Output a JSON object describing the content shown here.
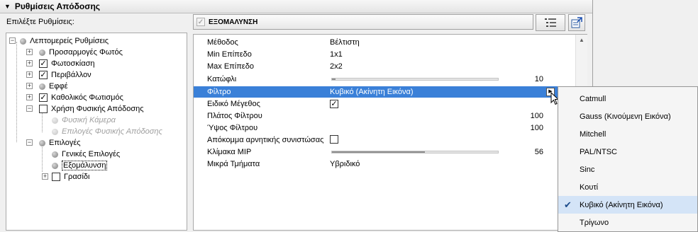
{
  "panel": {
    "title": "Ρυθμίσεις Απόδοσης",
    "select_label": "Επιλέξτε Ρυθμίσεις:"
  },
  "tree": {
    "root": "Λεπτομερείς Ρυθμίσεις",
    "items": [
      {
        "label": "Προσαρμογές Φωτός"
      },
      {
        "label": "Φωτοσκίαση",
        "checked": true
      },
      {
        "label": "Περιβάλλον",
        "checked": true
      },
      {
        "label": "Εφφέ"
      },
      {
        "label": "Καθολικός Φωτισμός",
        "checked": true
      },
      {
        "label": "Χρήση Φυσικής Απόδοσης",
        "checked": false
      },
      {
        "label": "Φυσική Κάμερα"
      },
      {
        "label": "Επιλογές Φυσικής Απόδοσης"
      },
      {
        "label": "Επιλογές"
      },
      {
        "label": "Γενικές Επιλογές"
      },
      {
        "label": "Εξομάλυνση"
      },
      {
        "label": "Γρασίδι",
        "checked": false
      }
    ]
  },
  "section": {
    "title": "ΕΞΟΜΑΛΥΝΣΗ"
  },
  "properties": [
    {
      "name": "Μέθοδος",
      "value": "Βέλτιστη"
    },
    {
      "name": "Min Επίπεδο",
      "value": "1x1"
    },
    {
      "name": "Max Επίπεδο",
      "value": "2x2"
    },
    {
      "name": "Κατώφλι",
      "number": "10",
      "level": 0.02
    },
    {
      "name": "Φίλτρο",
      "value": "Κυβικό (Ακίνητη Εικόνα)"
    },
    {
      "name": "Ειδικό Μέγεθος",
      "checked": true
    },
    {
      "name": "Πλάτος Φίλτρου",
      "number": "100"
    },
    {
      "name": "Ύψος Φίλτρου",
      "number": "100"
    },
    {
      "name": "Απόκομμα αρνητικής συνιστώσας",
      "checked": false
    },
    {
      "name": "Κλίμακα MIP",
      "number": "56",
      "level": 0.56
    },
    {
      "name": "Μικρά Τμήματα",
      "value": "Υβριδικό"
    }
  ],
  "filter_menu": {
    "options": [
      "Catmull",
      "Gauss (Κινούμενη Εικόνα)",
      "Mitchell",
      "PAL/NTSC",
      "Sinc",
      "Κουτί",
      "Κυβικό (Ακίνητη Εικόνα)",
      "Τρίγωνο"
    ],
    "selected": "Κυβικό (Ακίνητη Εικόνα)"
  },
  "icons": {
    "panel_collapse": "triangle-down-icon",
    "list_view": "list-view-icon",
    "export": "export-icon",
    "checkmark": "checkmark-icon"
  },
  "colors": {
    "highlight": "#3a80d8",
    "menu_hover": "#d4e4f7"
  }
}
